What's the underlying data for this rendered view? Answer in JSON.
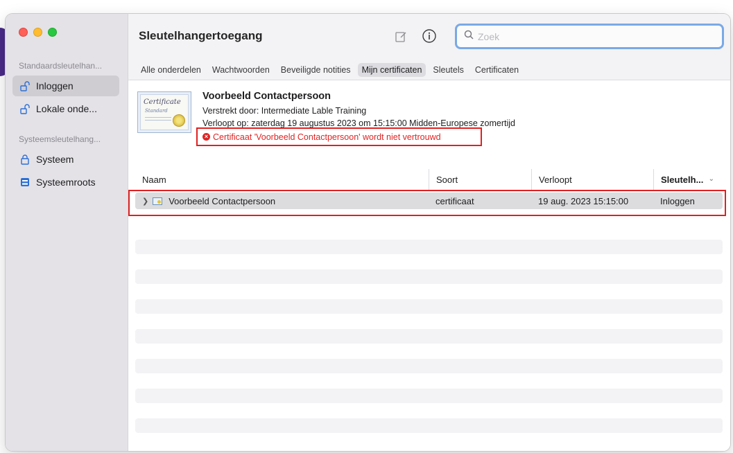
{
  "window": {
    "title": "Sleutelhangertoegang"
  },
  "sidebar": {
    "section_default": "Standaardsleutelhangers",
    "section_system": "Systeemsleutelhangers",
    "items": [
      {
        "label": "Inloggen",
        "icon": "unlock-icon",
        "selected": true
      },
      {
        "label": "Lokale onderdelen",
        "icon": "unlock-icon",
        "selected": false
      },
      {
        "label": "Systeem",
        "icon": "lock-icon",
        "selected": false
      },
      {
        "label": "Systeemroots",
        "icon": "cabinet-icon",
        "selected": false
      }
    ],
    "items_display": [
      "Inloggen",
      "Lokale onde...",
      "Systeem",
      "Systeemroots"
    ],
    "section_default_display": "Standaardsleutelhan...",
    "section_system_display": "Systeemsleutelhang..."
  },
  "search": {
    "placeholder": "Zoek",
    "value": ""
  },
  "tabs": [
    {
      "label": "Alle onderdelen",
      "active": false
    },
    {
      "label": "Wachtwoorden",
      "active": false
    },
    {
      "label": "Beveiligde notities",
      "active": false
    },
    {
      "label": "Mijn certificaten",
      "active": true
    },
    {
      "label": "Sleutels",
      "active": false
    },
    {
      "label": "Certificaten",
      "active": false
    }
  ],
  "detail": {
    "title": "Voorbeeld Contactpersoon",
    "issuer": "Verstrekt door: Intermediate Lable Training",
    "expires": "Verloopt op: zaterdag 19 augustus 2023 om 15:15:00 Midden-Europese zomertijd",
    "error": "Certificaat 'Voorbeeld Contactpersoon' wordt niet vertrouwd",
    "thumb_text": "Certificate",
    "thumb_sub": "Standard"
  },
  "table": {
    "columns": [
      "Naam",
      "Soort",
      "Verloopt",
      "Sleutelh..."
    ],
    "rows": [
      {
        "name": "Voorbeeld Contactpersoon",
        "kind": "certificaat",
        "expires": "19 aug. 2023 15:15:00",
        "keychain": "Inloggen"
      }
    ]
  },
  "colors": {
    "error": "#e02424",
    "highlight": "#e02020",
    "search_focus": "#7aa9e6"
  }
}
